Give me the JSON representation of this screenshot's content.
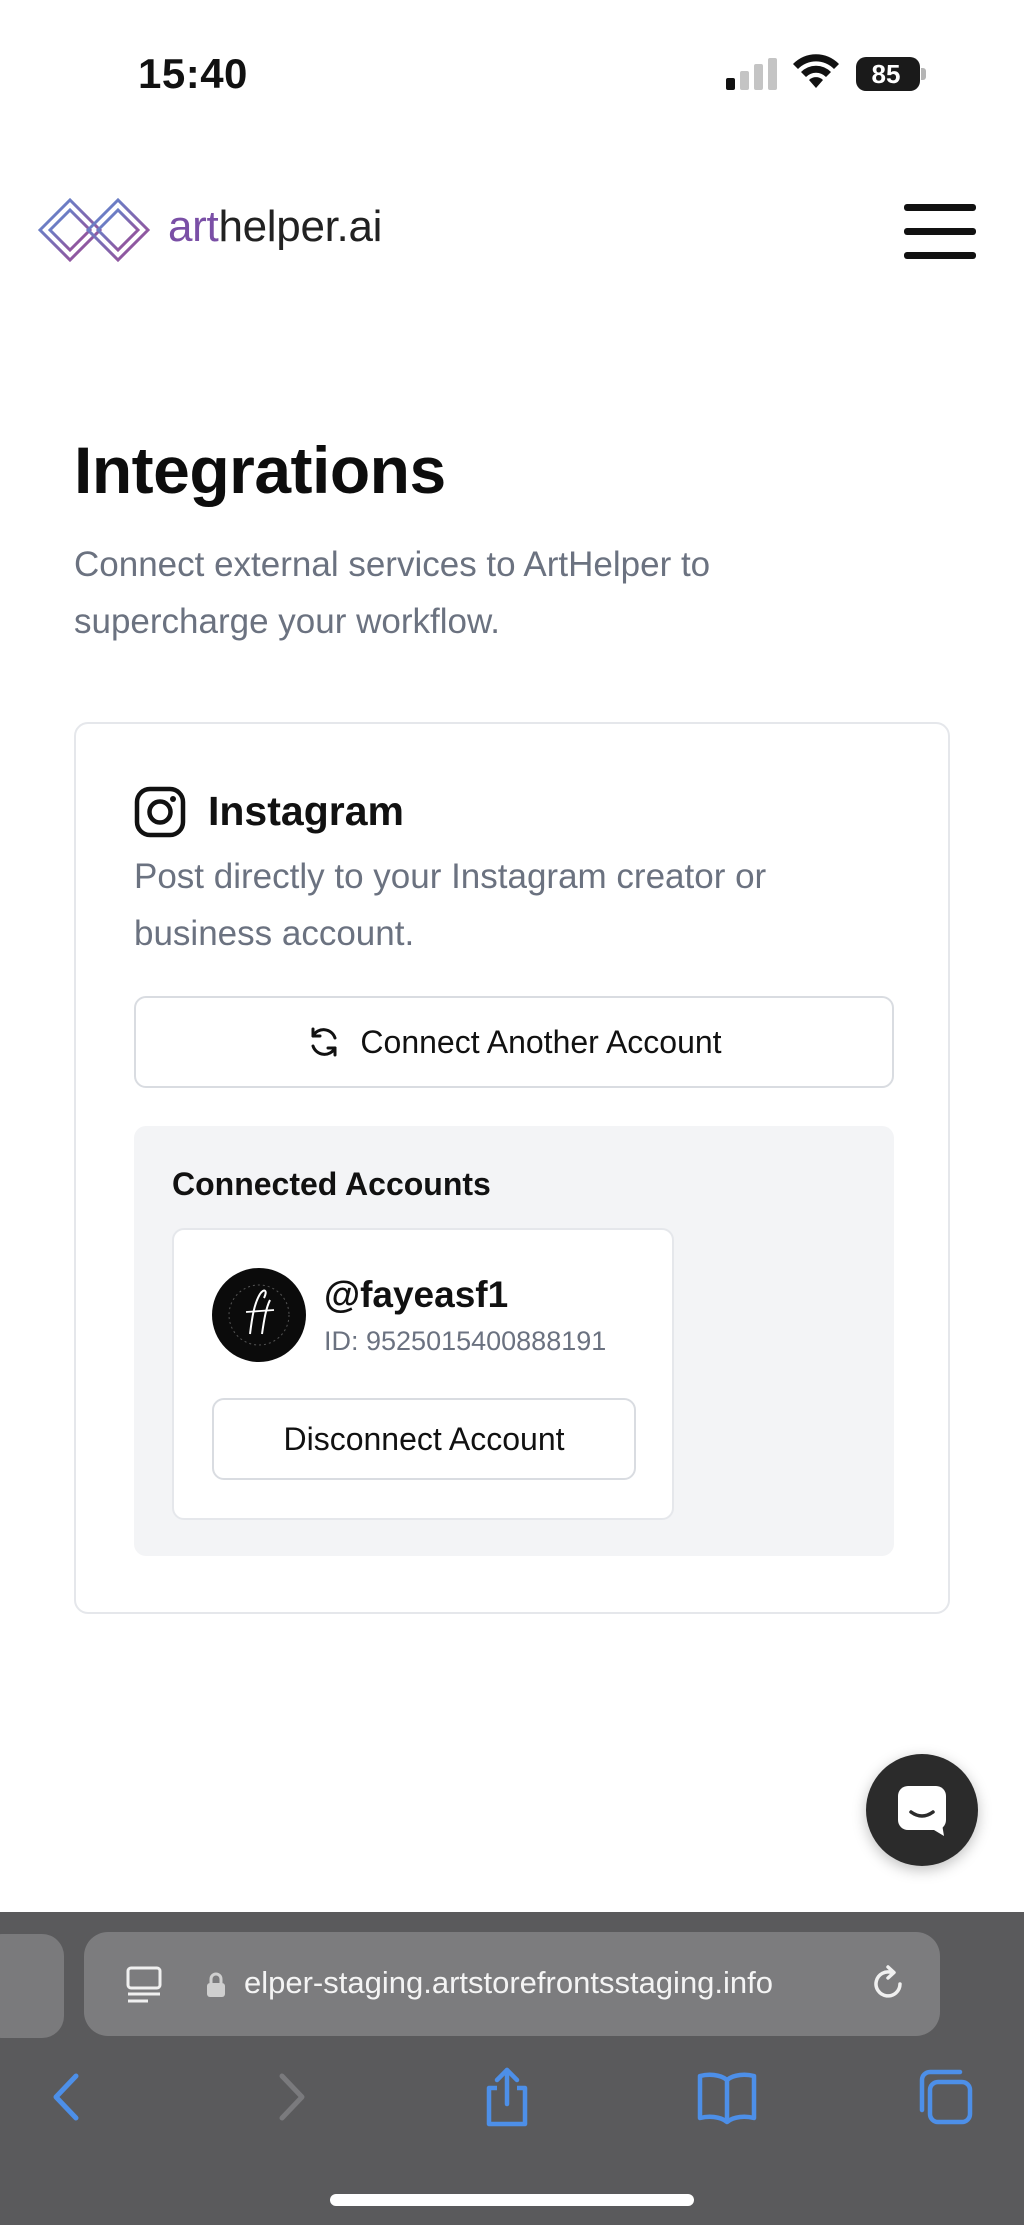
{
  "status_bar": {
    "time": "15:40",
    "battery_level": "85",
    "icons": [
      "signal-icon",
      "wifi-icon",
      "battery-icon"
    ]
  },
  "header": {
    "brand_accent": "art",
    "brand_rest": "helper.ai",
    "logo_icon": "interlocking-diamonds-logo",
    "menu_icon": "hamburger-menu-icon"
  },
  "page": {
    "title": "Integrations",
    "subtitle": "Connect external services to ArtHelper to supercharge your workflow."
  },
  "instagram": {
    "title": "Instagram",
    "description": "Post directly to your Instagram creator or business account.",
    "connect_label": "Connect Another Account",
    "connected_heading": "Connected Accounts",
    "accounts": [
      {
        "handle": "@fayeasf1",
        "id_text": "ID: 9525015400888191",
        "disconnect_label": "Disconnect Account"
      }
    ]
  },
  "browser": {
    "url": "elper-staging.artstorefrontsstaging.info",
    "toolbar_icons": [
      "back-icon",
      "forward-icon",
      "share-icon",
      "bookmarks-icon",
      "tabs-icon"
    ]
  },
  "colors": {
    "brand_accent": "#7a4fa6",
    "muted_text": "#6b7280",
    "panel_bg": "#f3f4f6",
    "browser_bar": "#5a5a5c",
    "toolbar_blue": "#3b82f6"
  }
}
